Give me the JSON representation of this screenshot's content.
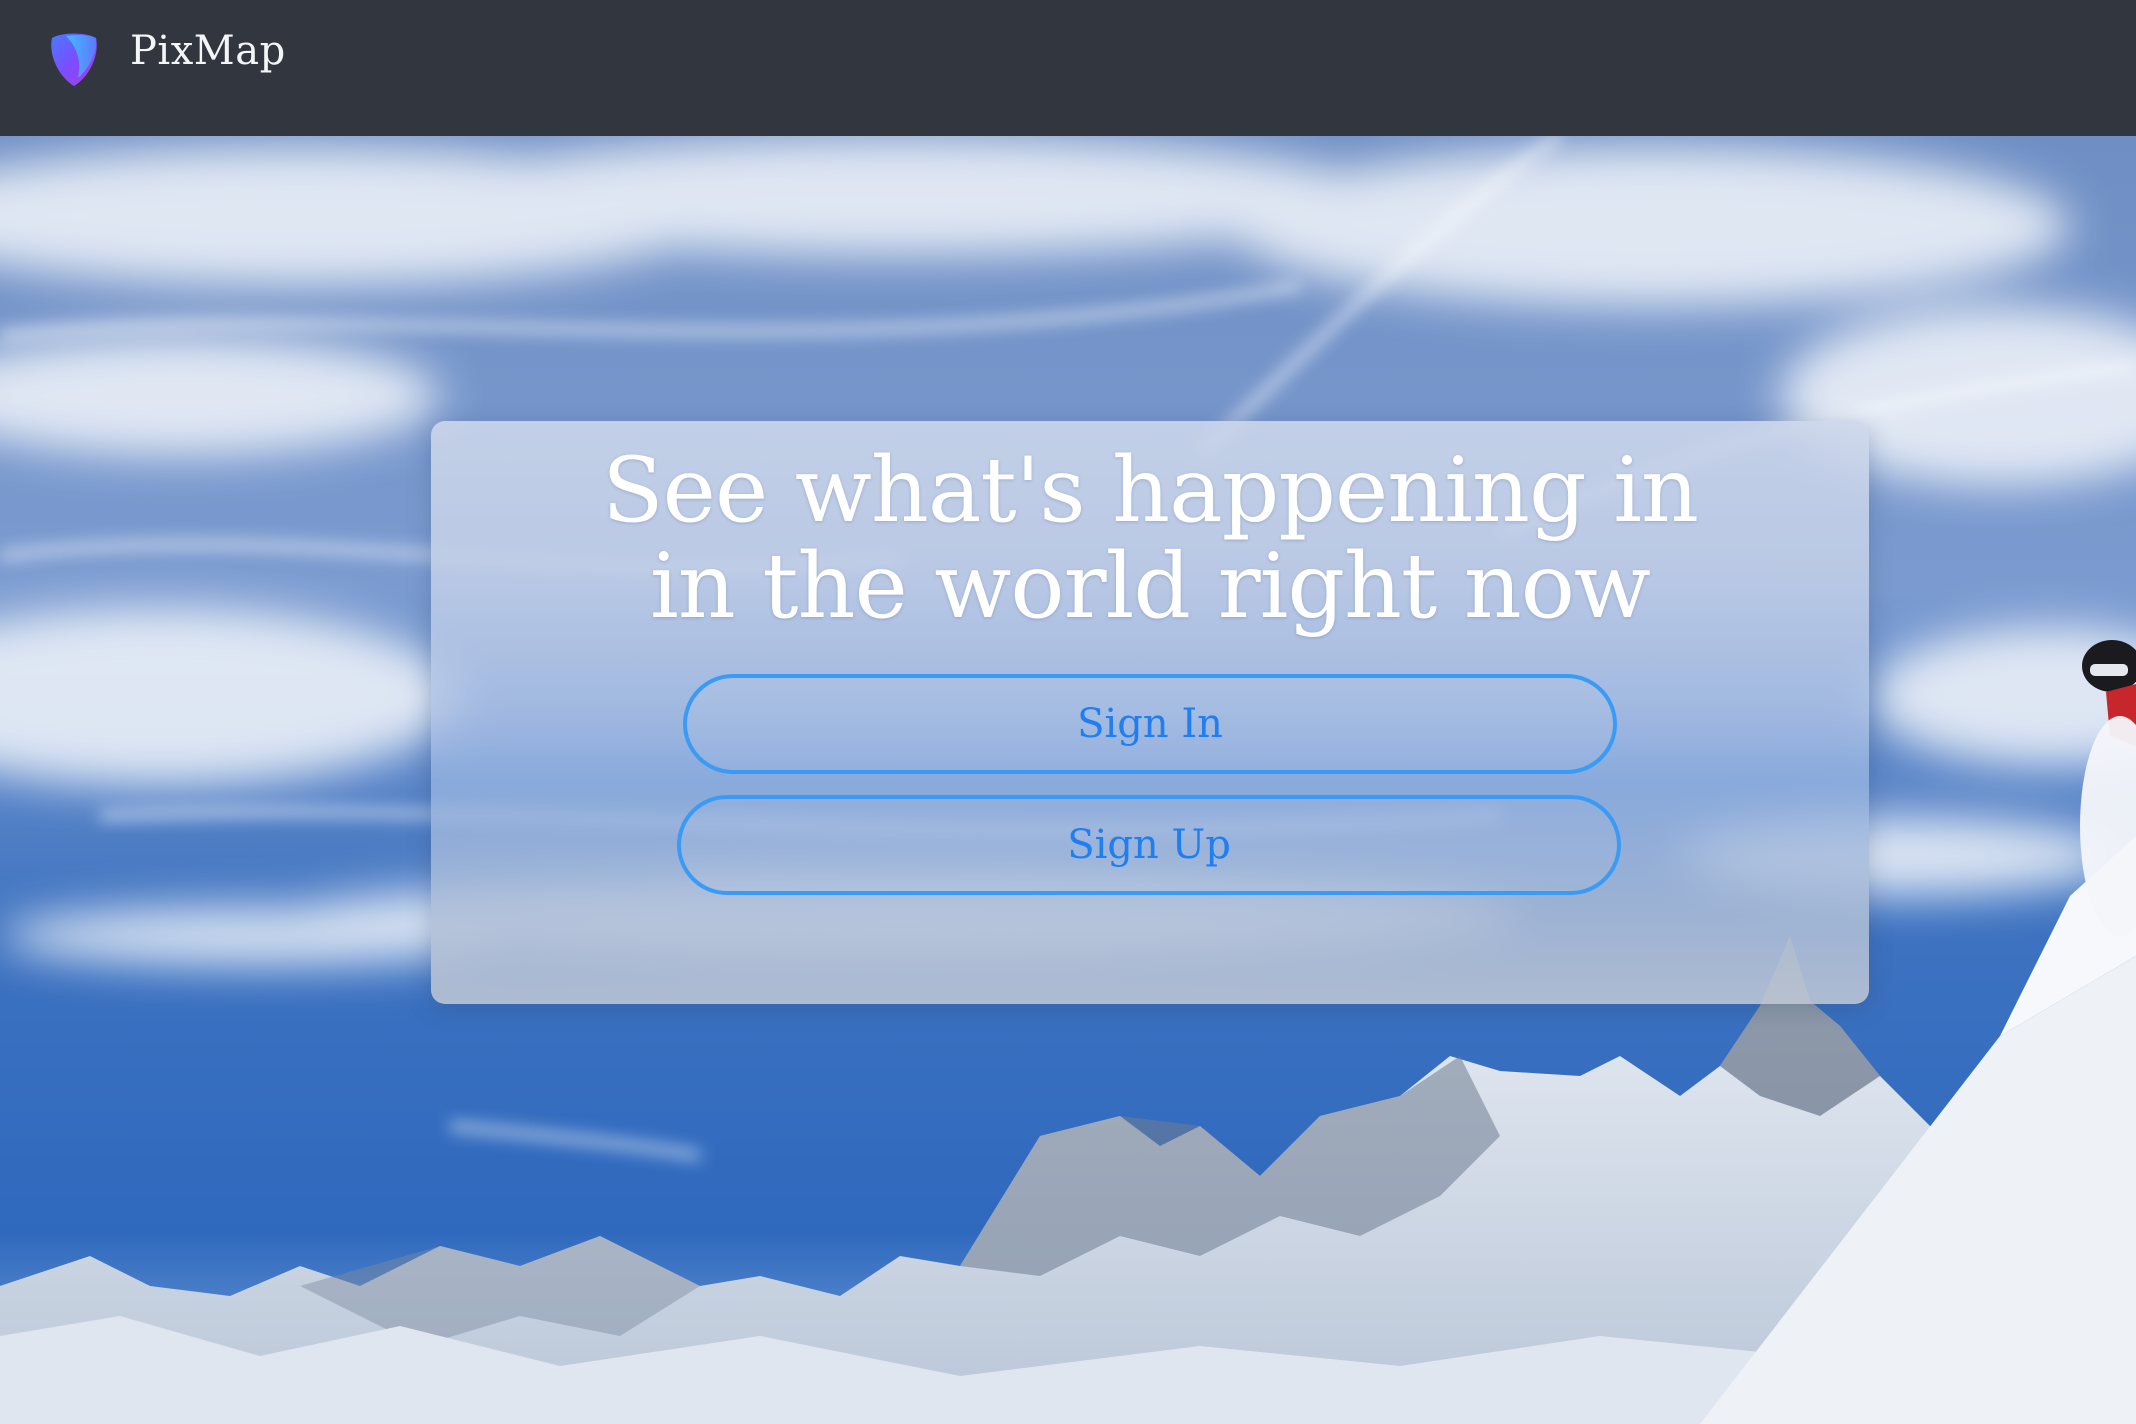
{
  "navbar": {
    "brand_name": "PixMap",
    "brand_icon": "pixmap-logo-icon",
    "background_color": "#32363e"
  },
  "hero": {
    "headline_line1": "See what's happening in",
    "headline_line2": "in the world right now",
    "sign_in_label": "Sign In",
    "sign_up_label": "Sign Up",
    "button_border_color": "#3a9bf5",
    "button_text_color": "#1f7ef0",
    "background_image": "snowy-mountain-skier-photo"
  }
}
